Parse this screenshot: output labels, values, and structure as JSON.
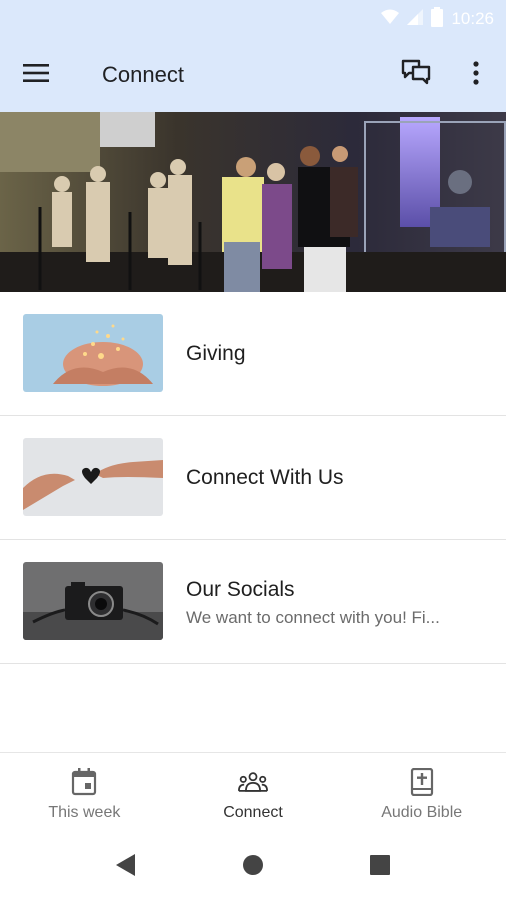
{
  "status_bar": {
    "time": "10:26",
    "icons": [
      "wifi-icon",
      "signal-icon",
      "battery-icon"
    ]
  },
  "app_bar": {
    "title": "Connect",
    "background_color": "#dbe8fb",
    "icons": [
      "menu-icon",
      "chat-icon",
      "more-vert-icon"
    ]
  },
  "hero": {
    "image": "worship-band-stage-photo"
  },
  "list": {
    "items": [
      {
        "title": "Giving",
        "subtitle": "",
        "thumbnail": "hands-holding-lights-photo"
      },
      {
        "title": "Connect With Us",
        "subtitle": "",
        "thumbnail": "hands-passing-heart-photo"
      },
      {
        "title": "Our Socials",
        "subtitle": "We want to connect with you! Fi...",
        "thumbnail": "camera-photo"
      }
    ]
  },
  "bottom_nav": {
    "items": [
      {
        "label": "This week",
        "icon": "calendar-icon",
        "active": false
      },
      {
        "label": "Connect",
        "icon": "people-icon",
        "active": true
      },
      {
        "label": "Audio Bible",
        "icon": "bible-icon",
        "active": false
      }
    ]
  },
  "system_nav": {
    "icons": [
      "back-icon",
      "home-icon",
      "recents-icon"
    ]
  }
}
